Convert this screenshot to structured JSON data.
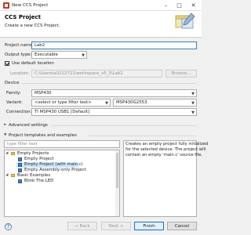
{
  "window": {
    "title": "New CCS Project",
    "icons": {
      "app": "ccs-app-icon",
      "minimize": "minimize-icon",
      "maximize": "maximize-icon",
      "close": "close-icon"
    }
  },
  "header": {
    "title": "CCS Project",
    "description": "Create a new CCS Project.",
    "icon": "wizard-banner-icon"
  },
  "form": {
    "project_name_label": "Project name:",
    "project_name_value": "Lab2",
    "output_type_label": "Output type:",
    "output_type_value": "Executable",
    "use_default_location_label": "Use default location",
    "use_default_location_checked": true,
    "location_label": "Location:",
    "location_value": "C:\\Users\\a0222721\\workspace_v5_3\\Lab2",
    "browse_label": "Browse..."
  },
  "device": {
    "section_label": "Device",
    "family_label": "Family:",
    "family_value": "MSP430",
    "variant_label": "Variant:",
    "variant_filter_placeholder": "<select or type filter text>",
    "variant_value": "MSP430G2553",
    "connection_label": "Connection:",
    "connection_value": "TI MSP430 USB1 [Default]"
  },
  "advanced": {
    "label": "Advanced settings",
    "expanded": false
  },
  "templates": {
    "label": "Project templates and examples",
    "expanded": true,
    "filter_placeholder": "type filter text",
    "tree": [
      {
        "label": "Empty Projects",
        "level": 0,
        "expanded": true,
        "icon": "folder-icon"
      },
      {
        "label": "Empty Project",
        "level": 1,
        "icon": "project-icon"
      },
      {
        "label": "Empty Project (with main.c)",
        "level": 1,
        "icon": "project-icon",
        "selected": true
      },
      {
        "label": "Empty Assembly-only Project",
        "level": 1,
        "icon": "project-icon"
      },
      {
        "label": "Basic Examples",
        "level": 0,
        "expanded": true,
        "icon": "folder-icon"
      },
      {
        "label": "Blink The LED",
        "level": 1,
        "icon": "project-icon"
      }
    ],
    "description": [
      "Creates an empty project fully initialized",
      "for the selected device. The project will",
      "contain an empty 'main.c' source-file."
    ]
  },
  "buttons": {
    "help_icon": "help-icon",
    "back": "< Back",
    "next": "Next >",
    "finish": "Finish",
    "cancel": "Cancel"
  },
  "colors": {
    "accent": "#0078d7",
    "selection": "#cce8ff"
  }
}
